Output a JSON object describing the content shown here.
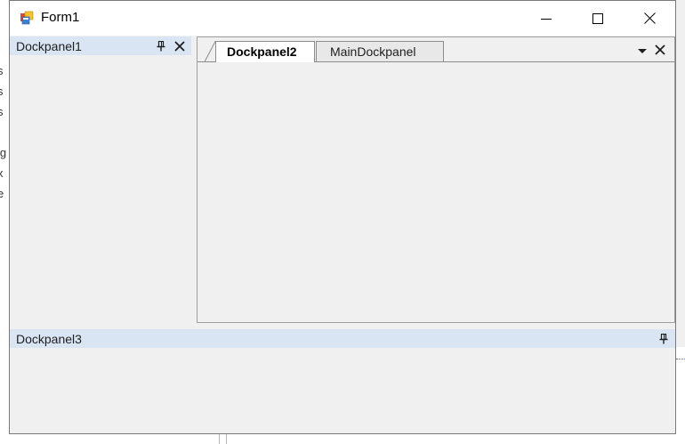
{
  "window": {
    "title": "Form1",
    "icon": "winforms-app-icon",
    "controls": [
      "minimize-icon",
      "maximize-icon",
      "close-icon"
    ]
  },
  "dockpanel1": {
    "title": "Dockpanel1",
    "icons": [
      "pin-icon",
      "close-icon"
    ]
  },
  "document_tabs": {
    "tabs": [
      {
        "label": "Dockpanel2",
        "active": true
      },
      {
        "label": "MainDockpanel",
        "active": false
      }
    ],
    "icons": [
      "dropdown-arrow-icon",
      "close-icon"
    ]
  },
  "dockpanel3": {
    "title": "Dockpanel3",
    "icons": [
      "pin-icon"
    ]
  },
  "background_fragments": [
    "s",
    "s",
    "s",
    "ig",
    "x",
    "e"
  ],
  "colors": {
    "panel_header": "#d9e5f3",
    "window_body": "#f0f0f0",
    "titlebar": "#ffffff"
  }
}
